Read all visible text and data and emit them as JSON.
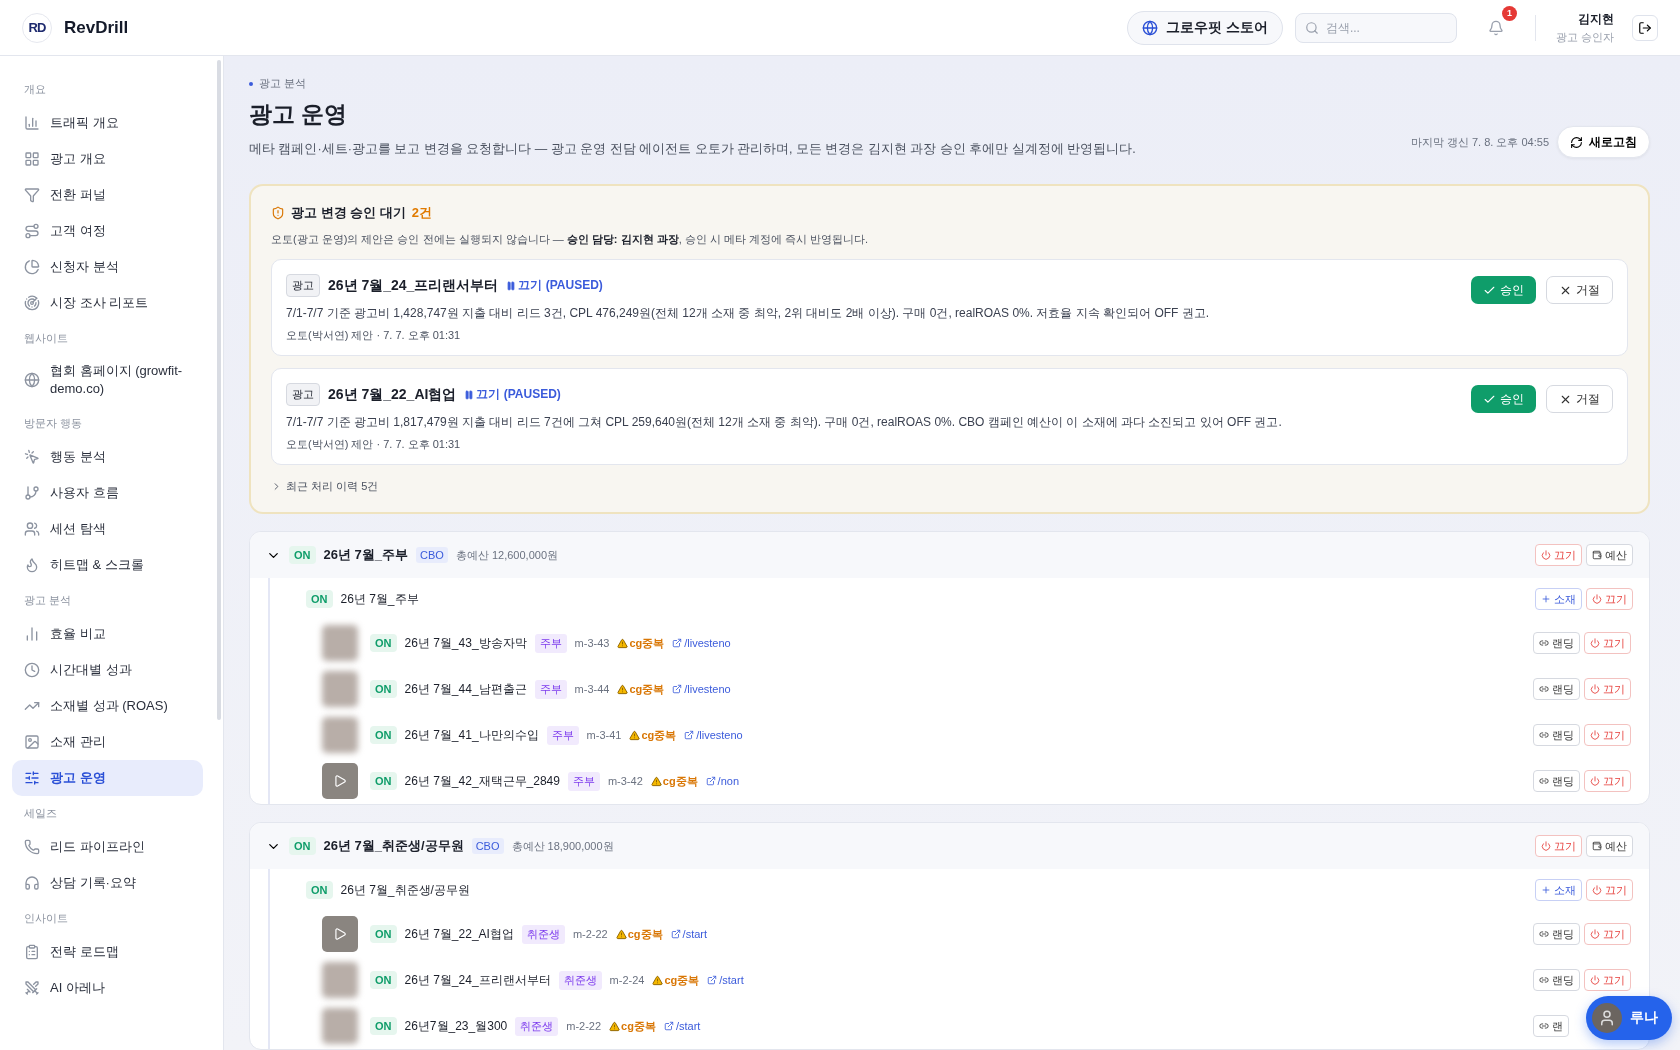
{
  "header": {
    "logo_mark": "RD",
    "brand": "RevDrill",
    "store_button": "그로우핏 스토어",
    "search": {
      "placeholder": "검색..."
    },
    "notification_count": "1",
    "user": {
      "name": "김지현",
      "role": "광고 승인자"
    }
  },
  "sidebar": {
    "sections": [
      {
        "title": "개요",
        "items": [
          {
            "label": "트래픽 개요",
            "selected": false
          },
          {
            "label": "광고 개요",
            "selected": false
          },
          {
            "label": "전환 퍼널",
            "selected": false
          },
          {
            "label": "고객 여정",
            "selected": false
          },
          {
            "label": "신청자 분석",
            "selected": false
          },
          {
            "label": "시장 조사 리포트",
            "selected": false
          }
        ]
      },
      {
        "title": "웹사이트",
        "items": [
          {
            "label": "협회 홈페이지 (growfit-demo.co)",
            "selected": false
          }
        ]
      },
      {
        "title": "방문자 행동",
        "items": [
          {
            "label": "행동 분석",
            "selected": false
          },
          {
            "label": "사용자 흐름",
            "selected": false
          },
          {
            "label": "세션 탐색",
            "selected": false
          },
          {
            "label": "히트맵 & 스크롤",
            "selected": false
          }
        ]
      },
      {
        "title": "광고 분석",
        "items": [
          {
            "label": "효율 비교",
            "selected": false
          },
          {
            "label": "시간대별 성과",
            "selected": false
          },
          {
            "label": "소재별 성과 (ROAS)",
            "selected": false
          },
          {
            "label": "소재 관리",
            "selected": false
          },
          {
            "label": "광고 운영",
            "selected": true
          }
        ]
      },
      {
        "title": "세일즈",
        "items": [
          {
            "label": "리드 파이프라인",
            "selected": false
          },
          {
            "label": "상담 기록·요약",
            "selected": false
          }
        ]
      },
      {
        "title": "인사이트",
        "items": [
          {
            "label": "전략 로드맵",
            "selected": false
          },
          {
            "label": "AI 아레나",
            "selected": false
          }
        ]
      }
    ]
  },
  "page": {
    "breadcrumb": "광고 분석",
    "title": "광고 운영",
    "description": "메타 캠페인·세트·광고를 보고 변경을 요청합니다 — 광고 운영 전담 에이전트 오토가 관리하며, 모든 변경은 김지현 과장 승인 후에만 실계정에 반영됩니다.",
    "last_updated": "마지막 갱신 7. 8. 오후 04:55",
    "refresh_button": "새로고침"
  },
  "approval": {
    "title": "광고 변경 승인 대기",
    "count": "2건",
    "description": "오토(광고 운영)의 제안은 승인 전에는 실행되지 않습니다 — **승인 담당: 김지현 과장**, 승인 시 메타 계정에 즉시 반영됩니다.",
    "proposals": [
      {
        "tag": "광고",
        "name": "26년 7월_24_프리랜서부터",
        "action": "끄기 (PAUSED)",
        "detail": "7/1-7/7 기준 광고비 1,428,747원 지출 대비 리드 3건, CPL 476,249원(전체 12개 소재 중 최악, 2위 대비도 2배 이상). 구매 0건, realROAS 0%. 저효율 지속 확인되어 OFF 권고.",
        "meta": "오토(박서연) 제안 · 7. 7. 오후 01:31",
        "approve": "승인",
        "reject": "거절"
      },
      {
        "tag": "광고",
        "name": "26년 7월_22_AI협업",
        "action": "끄기 (PAUSED)",
        "detail": "7/1-7/7 기준 광고비 1,817,479원 지출 대비 리드 7건에 그쳐 CPL 259,640원(전체 12개 소재 중 최악). 구매 0건, realROAS 0%. CBO 캠페인 예산이 이 소재에 과다 소진되고 있어 OFF 권고.",
        "meta": "오토(박서연) 제안 · 7. 7. 오후 01:31",
        "approve": "승인",
        "reject": "거절"
      }
    ],
    "history": {
      "label": "최근 처리 이력 5건",
      "expanded": false
    }
  },
  "campaigns": [
    {
      "status": "ON",
      "name": "26년 7월_주부",
      "tag": "CBO",
      "budget": "총예산 12,600,000원",
      "expanded": true,
      "off_button": "끄기",
      "budget_button": "예산",
      "adsets": [
        {
          "status": "ON",
          "name": "26년 7월_주부",
          "add_button": "소재",
          "off_button": "끄기",
          "ads": [
            {
              "kind": "image",
              "status": "ON",
              "name": "26년 7월_43_방송자막",
              "segment": "주부",
              "code": "m-3-43",
              "warning": "cg중복",
              "link": "/livesteno",
              "landing_button": "랜딩",
              "off_button": "끄기"
            },
            {
              "kind": "image",
              "status": "ON",
              "name": "26년 7월_44_남편출근",
              "segment": "주부",
              "code": "m-3-44",
              "warning": "cg중복",
              "link": "/livesteno",
              "landing_button": "랜딩",
              "off_button": "끄기"
            },
            {
              "kind": "image",
              "status": "ON",
              "name": "26년 7월_41_나만의수입",
              "segment": "주부",
              "code": "m-3-41",
              "warning": "cg중복",
              "link": "/livesteno",
              "landing_button": "랜딩",
              "off_button": "끄기"
            },
            {
              "kind": "video",
              "status": "ON",
              "name": "26년 7월_42_재택근무_2849",
              "segment": "주부",
              "code": "m-3-42",
              "warning": "cg중복",
              "link": "/non",
              "landing_button": "랜딩",
              "off_button": "끄기"
            }
          ]
        }
      ]
    },
    {
      "status": "ON",
      "name": "26년 7월_취준생/공무원",
      "tag": "CBO",
      "budget": "총예산 18,900,000원",
      "expanded": true,
      "off_button": "끄기",
      "budget_button": "예산",
      "adsets": [
        {
          "status": "ON",
          "name": "26년 7월_취준생/공무원",
          "add_button": "소재",
          "off_button": "끄기",
          "ads": [
            {
              "kind": "video",
              "status": "ON",
              "name": "26년 7월_22_AI협업",
              "segment": "취준생",
              "code": "m-2-22",
              "warning": "cg중복",
              "link": "/start",
              "landing_button": "랜딩",
              "off_button": "끄기"
            },
            {
              "kind": "image",
              "status": "ON",
              "name": "26년 7월_24_프리랜서부터",
              "segment": "취준생",
              "code": "m-2-24",
              "warning": "cg중복",
              "link": "/start",
              "landing_button": "랜딩",
              "off_button": "끄기"
            },
            {
              "kind": "image",
              "status": "ON",
              "name": "26년7월_23_월300",
              "segment": "취준생",
              "code": "m-2-22",
              "warning": "cg중복",
              "link": "/start",
              "landing_button": "랜"
            }
          ]
        }
      ]
    }
  ],
  "chat_button": {
    "label": "루나"
  }
}
